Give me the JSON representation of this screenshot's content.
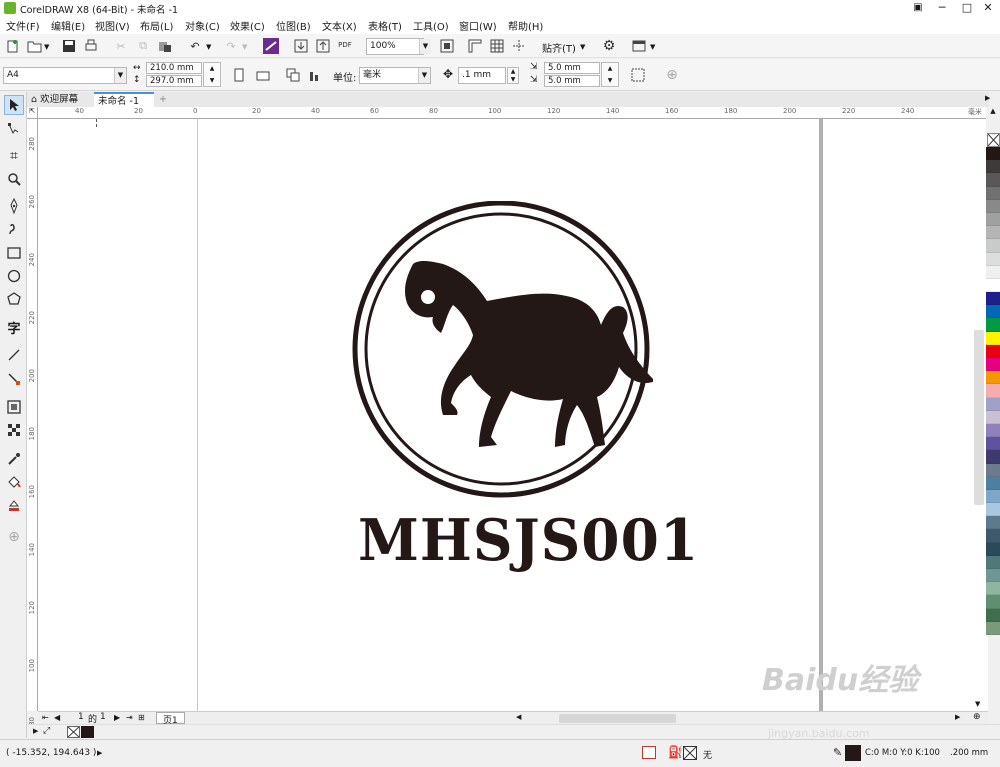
{
  "app": {
    "title": "CorelDRAW X8 (64-Bit) - 未命名 -1",
    "window_buttons": [
      "─",
      "□",
      "✕"
    ]
  },
  "menu": [
    "文件(F)",
    "编辑(E)",
    "视图(V)",
    "布局(L)",
    "对象(C)",
    "效果(C)",
    "位图(B)",
    "文本(X)",
    "表格(T)",
    "工具(O)",
    "窗口(W)",
    "帮助(H)"
  ],
  "toolbar": {
    "zoom": "100%",
    "snap_label": "贴齐(T)",
    "pdf_label": "PDF"
  },
  "property_bar": {
    "page_size": "A4",
    "width": "210.0 mm",
    "height": "297.0 mm",
    "unit_label": "单位:",
    "unit_value": "毫米",
    "nudge": ".1 mm",
    "dup_x": "5.0 mm",
    "dup_y": "5.0 mm"
  },
  "doc_tabs": {
    "welcome": "欢迎屏幕",
    "document": "未命名 -1"
  },
  "rulers": {
    "h_labels": [
      "40",
      "20",
      "0",
      "20",
      "40",
      "60",
      "80",
      "100",
      "120",
      "140",
      "160",
      "180",
      "200",
      "220",
      "240"
    ],
    "h_unit": "毫米",
    "v_labels": [
      "280",
      "260",
      "240",
      "220",
      "200",
      "180",
      "160",
      "140",
      "120",
      "100",
      "80"
    ]
  },
  "artwork": {
    "logo_text": "MHSJS001"
  },
  "page_nav": {
    "current": "1",
    "of_label": "的",
    "total": "1",
    "page_tab": "页1"
  },
  "status": {
    "coords": "( -15.352, 194.643 )",
    "fill_none": "无",
    "color_info": "C:0 M:0 Y:0 K:100",
    "stroke_width": ".200 mm"
  },
  "watermark": {
    "brand": "Baidu经验",
    "url": "jingyan.baidu.com"
  },
  "colors": {
    "accent": "#6ab42d",
    "artwork": "#231815",
    "palette": [
      "#231815",
      "#3e3a39",
      "#595757",
      "#727171",
      "#898989",
      "#9fa0a0",
      "#b5b5b6",
      "#c9caca",
      "#dcdddd",
      "#efefef",
      "#ffffff",
      "#1d2088",
      "#0068b7",
      "#009944",
      "#fff100",
      "#e60012",
      "#e4007f",
      "#f39800",
      "#f6adad",
      "#a0a0c8",
      "#c9c0d3",
      "#8f82bc",
      "#5f52a0",
      "#3e3a6e",
      "#6c7b8b",
      "#4d7fa0",
      "#7ea6c8",
      "#a7c8e0",
      "#5c7a8c",
      "#3d5a6a",
      "#2a4a5a",
      "#507878",
      "#6f9595",
      "#8fb5a0",
      "#5f8f6e",
      "#3f6f4e",
      "#7a9a7a"
    ]
  }
}
